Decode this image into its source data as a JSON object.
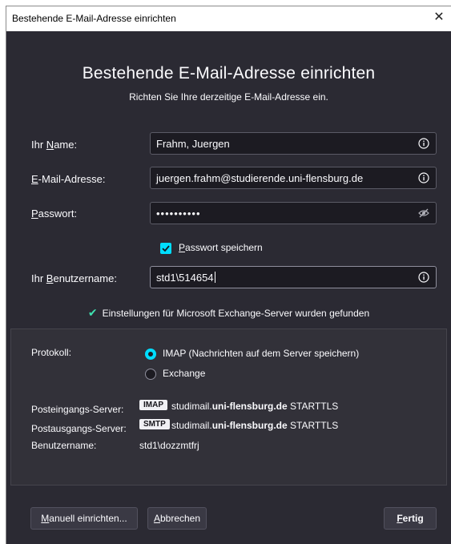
{
  "window": {
    "title": "Bestehende E-Mail-Adresse einrichten"
  },
  "header": {
    "title": "Bestehende E-Mail-Adresse einrichten",
    "subtitle": "Richten Sie Ihre derzeitige E-Mail-Adresse ein."
  },
  "form": {
    "name_label_pre": "Ihr ",
    "name_label_acc": "N",
    "name_label_post": "ame:",
    "name_value": "Frahm, Juergen",
    "email_label_acc": "E",
    "email_label_post": "-Mail-Adresse:",
    "email_value": "juergen.frahm@studierende.uni-flensburg.de",
    "password_label_acc": "P",
    "password_label_post": "asswort:",
    "password_value": "••••••••••",
    "remember_label_acc": "P",
    "remember_label_post": "asswort speichern",
    "remember_checked": true,
    "username_label_pre": "Ihr ",
    "username_label_acc": "B",
    "username_label_post": "enutzername:",
    "username_value": "std1\\514654"
  },
  "status": {
    "found_text": "Einstellungen für Microsoft Exchange-Server wurden gefunden"
  },
  "config": {
    "protocol_label": "Protokoll:",
    "options": [
      {
        "label": "IMAP (Nachrichten auf dem Server speichern)",
        "selected": true
      },
      {
        "label": "Exchange",
        "selected": false
      }
    ],
    "incoming_label": "Posteingangs-Server:",
    "incoming_badge": "IMAP",
    "incoming_host_pre": "studimail.",
    "incoming_host_bold": "uni-flensburg.de",
    "incoming_security": "STARTTLS",
    "outgoing_label": "Postausgangs-Server:",
    "outgoing_badge": "SMTP",
    "outgoing_host_pre": "studimail.",
    "outgoing_host_bold": "uni-flensburg.de",
    "outgoing_security": "STARTTLS",
    "username_label": "Benutzername:",
    "username_value": "std1\\dozzmtfrj"
  },
  "buttons": {
    "manual_acc": "M",
    "manual_post": "anuell einrichten...",
    "cancel_acc": "A",
    "cancel_post": "bbrechen",
    "done_acc": "F",
    "done_post": "ertig"
  },
  "colors": {
    "accent": "#00ddff",
    "background": "#2b2a33",
    "input_bg": "#1c1b22",
    "success": "#3fe1b0"
  },
  "icons": [
    "close-icon",
    "info-icon",
    "eye-slash-icon",
    "checkmark-icon",
    "check-icon"
  ]
}
